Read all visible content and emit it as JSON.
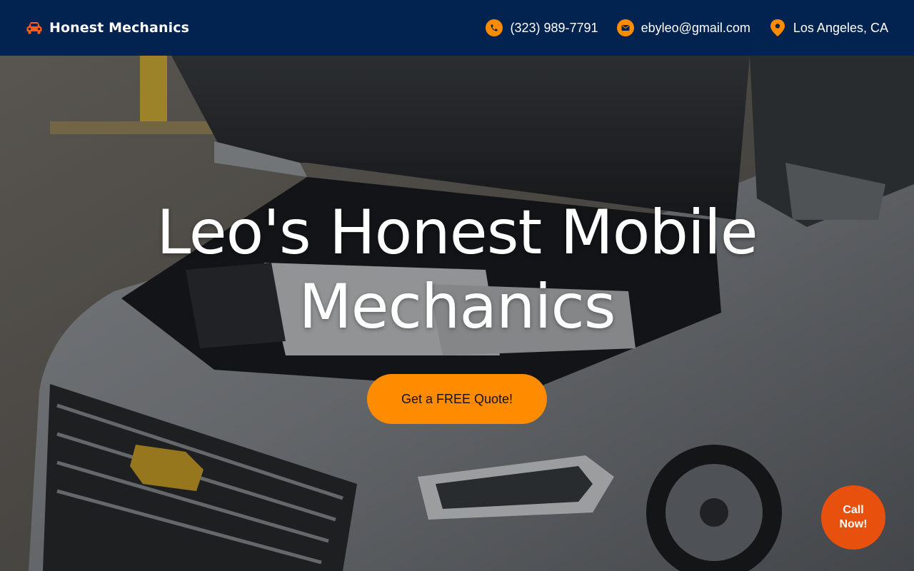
{
  "brand": {
    "name": "Honest Mechanics",
    "icon": "car-icon",
    "icon_color": "#ff5a1f"
  },
  "contact": {
    "phone": "(323) 989-7791",
    "email": "ebyleo@gmail.com",
    "location": "Los Angeles, CA",
    "icons": [
      "phone-icon",
      "mail-icon",
      "map-pin-icon"
    ]
  },
  "hero": {
    "title_line1": "Leo's Honest Mobile",
    "title_line2": "Mechanics",
    "cta_label": "Get a FREE Quote!",
    "image_icon": "car-engine-photo"
  },
  "call_button": {
    "line1": "Call",
    "line2": "Now!"
  },
  "colors": {
    "header_bg": "#02234f",
    "accent": "#ff8c00",
    "call_button": "#e8500e",
    "text_light": "#ffffff"
  }
}
